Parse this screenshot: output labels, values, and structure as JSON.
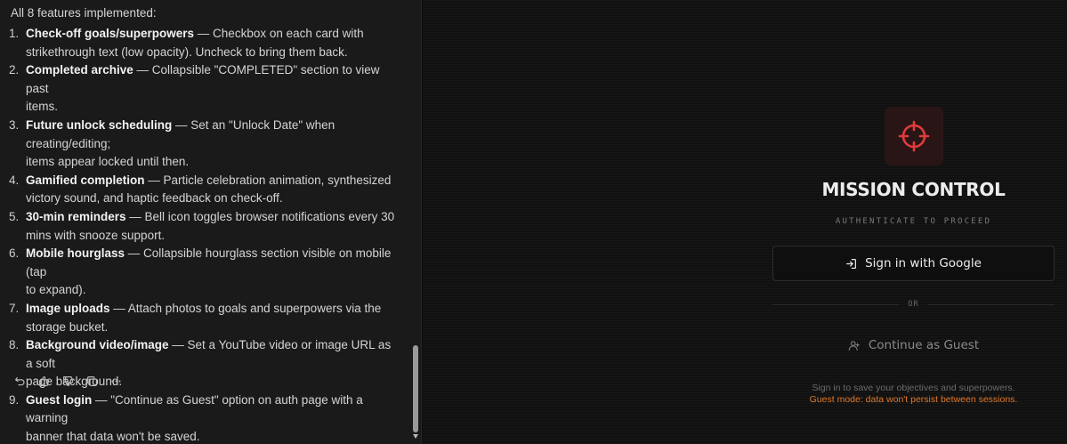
{
  "chat": {
    "intro": "All 8 features implemented:",
    "features": [
      {
        "num": "1.",
        "title": "Check-off goals/superpowers",
        "lines": [
          " — Checkbox on each card with",
          "strikethrough text (low opacity). Uncheck to bring them back."
        ]
      },
      {
        "num": "2.",
        "title": "Completed archive",
        "lines": [
          " — Collapsible \"COMPLETED\" section to view past",
          "items."
        ]
      },
      {
        "num": "3.",
        "title": "Future unlock scheduling",
        "lines": [
          " — Set an \"Unlock Date\" when creating/editing;",
          "items appear locked until then."
        ]
      },
      {
        "num": "4.",
        "title": "Gamified completion",
        "lines": [
          " — Particle celebration animation, synthesized",
          "victory sound, and haptic feedback on check-off."
        ]
      },
      {
        "num": "5.",
        "title": "30-min reminders",
        "lines": [
          " — Bell icon toggles browser notifications every 30",
          "mins with snooze support."
        ]
      },
      {
        "num": "6.",
        "title": "Mobile hourglass",
        "lines": [
          " — Collapsible hourglass section visible on mobile (tap",
          "to expand)."
        ]
      },
      {
        "num": "7.",
        "title": "Image uploads",
        "lines": [
          " — Attach photos to goals and superpowers via the",
          "storage bucket."
        ]
      },
      {
        "num": "8.",
        "title": "Background video/image",
        "lines": [
          " — Set a YouTube video or image URL as a soft",
          "page background."
        ]
      },
      {
        "num": "9.",
        "title": "Guest login",
        "lines": [
          " — \"Continue as Guest\" option on auth page with a warning",
          "banner that data won't be saved."
        ]
      }
    ],
    "actions": [
      "undo-icon",
      "thumbs-up-icon",
      "thumbs-down-icon",
      "copy-icon",
      "more-icon"
    ]
  },
  "auth": {
    "title": "MISSION CONTROL",
    "subtitle": "AUTHENTICATE TO PROCEED",
    "google_label": "Sign in with Google",
    "divider_label": "OR",
    "guest_label": "Continue as Guest",
    "note": "Sign in to save your objectives and superpowers.",
    "guest_warning": "Guest mode: data won't persist between sessions.",
    "accent_color": "#e23b3b",
    "warning_color": "#e0782a"
  }
}
